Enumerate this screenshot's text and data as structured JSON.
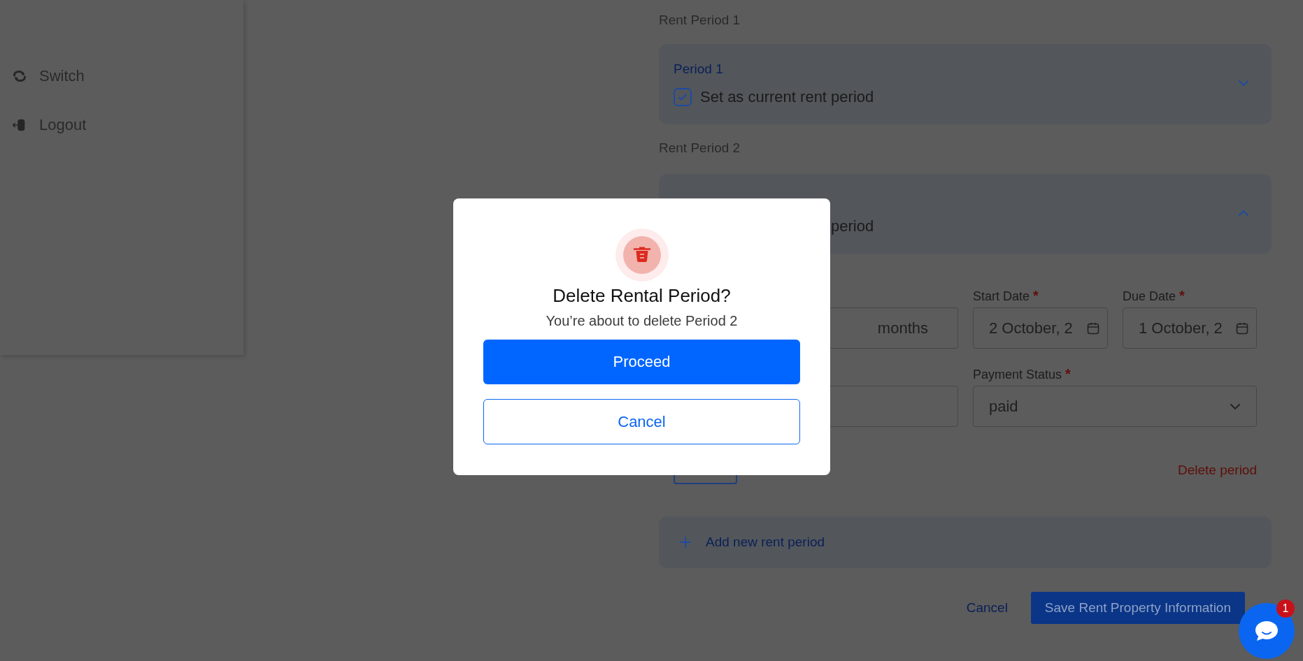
{
  "sidebar": {
    "items": [
      {
        "kind": "switch",
        "label": "Switch"
      },
      {
        "kind": "logout",
        "label": "Logout"
      }
    ]
  },
  "rent_periods": [
    {
      "heading": "Rent Period 1",
      "title": "Period 1",
      "current_label": "Set as current rent period",
      "current": true,
      "expanded": false
    },
    {
      "heading": "Rent Period 2",
      "current_label": "period",
      "expanded": true,
      "fields": [
        {
          "kind": "text",
          "value": "months"
        },
        {
          "kind": "date",
          "label": "Start Date",
          "required_mark": "*",
          "value": "2 October, 2"
        },
        {
          "kind": "date",
          "label": "Due Date",
          "required_mark": "*",
          "value": "1 October, 2"
        },
        {
          "kind": "text"
        },
        {
          "kind": "select",
          "label": "Payment Status",
          "required_mark": "*",
          "value": "paid"
        }
      ],
      "delete_link": "Delete period"
    }
  ],
  "add_period": "Add new rent period",
  "footer": {
    "cancel": "Cancel",
    "save": "Save Rent Property Information"
  },
  "modal": {
    "title": "Delete Rental Period?",
    "message": "You’re about to delete Period 2",
    "proceed": "Proceed",
    "cancel": "Cancel"
  },
  "chat": {
    "badge": "1"
  }
}
